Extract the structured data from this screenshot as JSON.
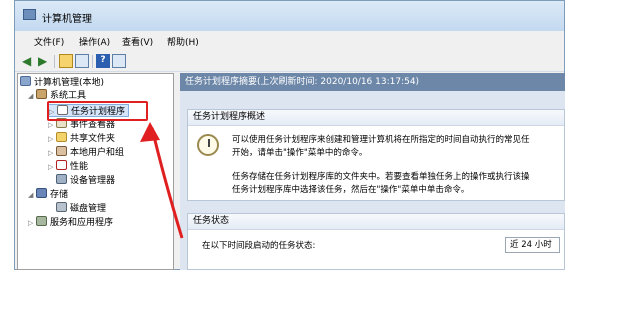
{
  "window": {
    "title": "计算机管理"
  },
  "menu": [
    {
      "label": "文件(F)"
    },
    {
      "label": "操作(A)"
    },
    {
      "label": "查看(V)"
    },
    {
      "label": "帮助(H)"
    }
  ],
  "toolbar": {
    "icons": [
      "back-arrow-icon",
      "forward-arrow-icon",
      "up-folder-icon",
      "show-hide-tree-icon",
      "help-icon",
      "properties-icon"
    ],
    "help_glyph": "?"
  },
  "tree": {
    "root": "计算机管理(本地)",
    "system_tools": "系统工具",
    "task_scheduler": "任务计划程序",
    "event_viewer": "事件查看器",
    "shared_folders": "共享文件夹",
    "local_users": "本地用户和组",
    "performance": "性能",
    "device_manager": "设备管理器",
    "storage": "存储",
    "disk_management": "磁盘管理",
    "services_apps": "服务和应用程序"
  },
  "panel": {
    "header": "任务计划程序摘要(上次刷新时间: 2020/10/16 13:17:54)",
    "overview": {
      "title": "任务计划程序概述",
      "line1": "可以使用任务计划程序来创建和管理计算机将在所指定的时间自动执行的常见任",
      "line2": "开始，请单击\"操作\"菜单中的命令。",
      "line3": "任务存储在任务计划程序库的文件夹中。若要查看单独任务上的操作或执行该操",
      "line4": "任务计划程序库中选择该任务，然后在\"操作\"菜单中单击命令。"
    },
    "status": {
      "title": "任务状态",
      "label": "在以下时间段启动的任务状态:",
      "select_value": "近 24 小时"
    }
  },
  "colors": {
    "highlight": "#e02020",
    "panel_header": "#6d87a8"
  }
}
